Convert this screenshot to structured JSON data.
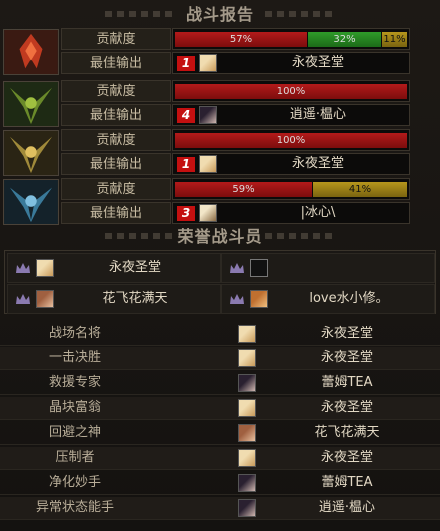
{
  "header": {
    "title": "战斗报告"
  },
  "bosses": [
    {
      "emblem": "red-flame-emblem",
      "contribution_label": "贡献度",
      "bars": [
        {
          "label": "57%",
          "value": 57,
          "color": "red"
        },
        {
          "label": "32%",
          "value": 32,
          "color": "green"
        },
        {
          "label": "11%",
          "value": 11,
          "color": "gold"
        }
      ],
      "best_label": "最佳输出",
      "rank": "1",
      "avatar": "blonde-avatar",
      "player": "永夜圣堂"
    },
    {
      "emblem": "green-horned-emblem",
      "contribution_label": "贡献度",
      "bars": [
        {
          "label": "100%",
          "value": 100,
          "color": "red"
        }
      ],
      "best_label": "最佳输出",
      "rank": "4",
      "avatar": "dark-hair-avatar",
      "player": "逍遥·榅心"
    },
    {
      "emblem": "gold-horned-emblem",
      "contribution_label": "贡献度",
      "bars": [
        {
          "label": "100%",
          "value": 100,
          "color": "red"
        }
      ],
      "best_label": "最佳输出",
      "rank": "1",
      "avatar": "blonde-avatar",
      "player": "永夜圣堂"
    },
    {
      "emblem": "blue-ice-emblem",
      "contribution_label": "贡献度",
      "bars": [
        {
          "label": "59%",
          "value": 59,
          "color": "red"
        },
        {
          "label": "41%",
          "value": 41,
          "color": "gold"
        }
      ],
      "best_label": "最佳输出",
      "rank": "3",
      "avatar": "light-avatar",
      "player": "|冰心\\"
    }
  ],
  "honor": {
    "title": "荣誉战斗员",
    "members": [
      {
        "name": "永夜圣堂",
        "avatar": "blonde-avatar"
      },
      {
        "name": "",
        "avatar": "empty-slot"
      },
      {
        "name": "花飞花满天",
        "avatar": "auburn-avatar"
      },
      {
        "name": "love水小修。",
        "avatar": "orange-avatar"
      }
    ]
  },
  "awards": [
    {
      "title": "战场名将",
      "winner": "永夜圣堂",
      "avatar": "blonde-avatar"
    },
    {
      "title": "一击决胜",
      "winner": "永夜圣堂",
      "avatar": "blonde-avatar"
    },
    {
      "title": "救援专家",
      "winner": "蕾姆TEA",
      "avatar": "dark-hair-avatar"
    },
    {
      "title": "晶块富翁",
      "winner": "永夜圣堂",
      "avatar": "blonde-avatar"
    },
    {
      "title": "回避之神",
      "winner": "花飞花满天",
      "avatar": "auburn-avatar"
    },
    {
      "title": "压制者",
      "winner": "永夜圣堂",
      "avatar": "blonde-avatar"
    },
    {
      "title": "净化妙手",
      "winner": "蕾姆TEA",
      "avatar": "dark-hair-avatar"
    },
    {
      "title": "异常状态能手",
      "winner": "逍遥·榅心",
      "avatar": "dark-hair-avatar"
    }
  ]
}
